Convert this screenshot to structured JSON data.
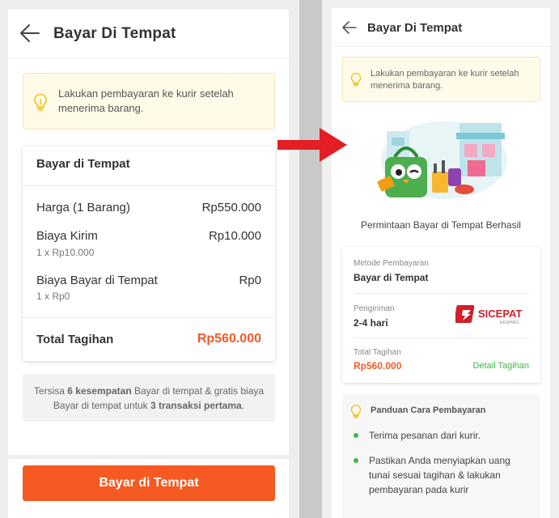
{
  "left": {
    "header": {
      "title": "Bayar Di Tempat"
    },
    "notice": {
      "text": "Lakukan pembayaran ke kurir setelah menerima barang."
    },
    "summary": {
      "title": "Bayar di Tempat",
      "rows": [
        {
          "label": "Harga (1 Barang)",
          "amount": "Rp550.000",
          "sub": ""
        },
        {
          "label": "Biaya Kirim",
          "amount": "Rp10.000",
          "sub": "1 x Rp10.000"
        },
        {
          "label": "Biaya Bayar di Tempat",
          "amount": "Rp0",
          "sub": "1 x Rp0"
        }
      ],
      "total_label": "Total Tagihan",
      "total_amount": "Rp560.000"
    },
    "info": {
      "part1": "Tersisa ",
      "bold1": "6 kesempatan",
      "part2": " Bayar di tempat & gratis biaya Bayar di tempat untuk ",
      "bold2": "3 transaksi pertama",
      "part3": "."
    },
    "pay_button": "Bayar di Tempat"
  },
  "right": {
    "header": {
      "title": "Bayar Di Tempat"
    },
    "notice": {
      "text": "Lakukan pembayaran ke kurir setelah menerima barang."
    },
    "success_text": "Permintaan Bayar di Tempat Berhasil",
    "detail": {
      "method_label": "Metode Pembayaran",
      "method_value": "Bayar di Tempat",
      "shipping_label": "Pengiriman",
      "shipping_value": "2-4 hari",
      "courier_logo_text": "SICEPAT",
      "courier_logo_sub": "EKSPRES",
      "total_label": "Total Tagihan",
      "total_value": "Rp560.000",
      "detail_link": "Detail Tagihan"
    },
    "guide": {
      "title": "Panduan Cara Pembayaran",
      "steps": [
        "Terima pesanan dari kurir.",
        "Pastikan Anda menyiapkan uang tunai sesuai tagihan & lakukan pembayaran pada kurir"
      ]
    }
  },
  "colors": {
    "accent_orange": "#f65a22",
    "total_orange": "#f05a2a",
    "green": "#42b549",
    "notice_bg": "#fffbe8",
    "arrow_red": "#e31e24"
  }
}
